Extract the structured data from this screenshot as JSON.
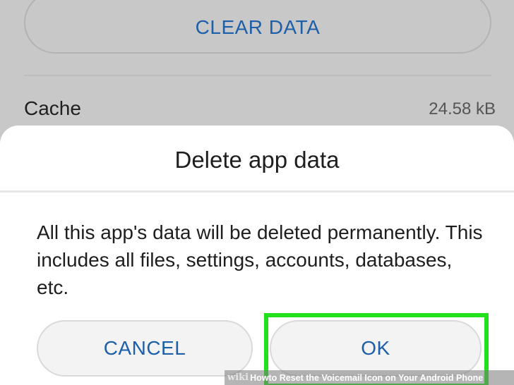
{
  "background": {
    "clear_data_label": "CLEAR DATA",
    "cache_label": "Cache",
    "cache_value": "24.58 kB"
  },
  "dialog": {
    "title": "Delete app data",
    "message": "All this app's data will be deleted permanently. This includes all files, settings, accounts, databases, etc.",
    "cancel_label": "CANCEL",
    "ok_label": "OK"
  },
  "highlight_color": "#22e01c",
  "accent_color": "#1d5fa8",
  "watermark": {
    "brand": "wiki",
    "brand_suffix": "How",
    "caption": " to Reset the Voicemail Icon on Your Android Phone"
  }
}
